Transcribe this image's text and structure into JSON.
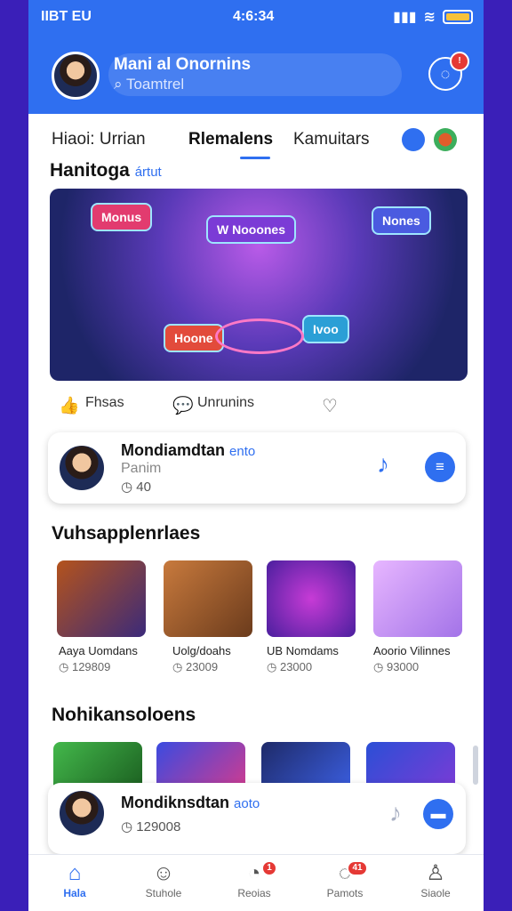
{
  "status": {
    "carrier": "IIBT EU",
    "time": "4:6:34"
  },
  "header": {
    "name": "Mani al Onornins",
    "search": "Toamtrel",
    "badge_icon": "notification-icon"
  },
  "tabs": [
    "Hiaoi: Urrian",
    "Rlemalens",
    "Kamuitars"
  ],
  "section1": {
    "title": "Hanitoga",
    "tag": "ártut"
  },
  "banner": {
    "chips": [
      "Monus",
      "W Nooones",
      "Nones",
      "Hoone",
      "Ivoo"
    ]
  },
  "reactions": {
    "like": "Fhsas",
    "comment": "Unrunins"
  },
  "card1": {
    "name": "Mondiamdtan",
    "tag": "ento",
    "sub": "Panim",
    "meta": "40"
  },
  "section2": {
    "title": "Vuhsapplenrlaes"
  },
  "thumbs": [
    {
      "label": "Aaya Uomdans",
      "meta": "129809"
    },
    {
      "label": "Uolg/doahs",
      "meta": "23009"
    },
    {
      "label": "UB Nomdams",
      "meta": "23000"
    },
    {
      "label": "Aoorio Vilinnes",
      "meta": "93000"
    }
  ],
  "section3": {
    "title": "Nohikansoloens"
  },
  "card2": {
    "name": "Mondiknsdtan",
    "tag": "aoto",
    "meta": "129008"
  },
  "nav": [
    "Hala",
    "Stuhole",
    "Reoias",
    "Pamots",
    "Siaole"
  ],
  "nav_badges": [
    "1",
    "41"
  ]
}
